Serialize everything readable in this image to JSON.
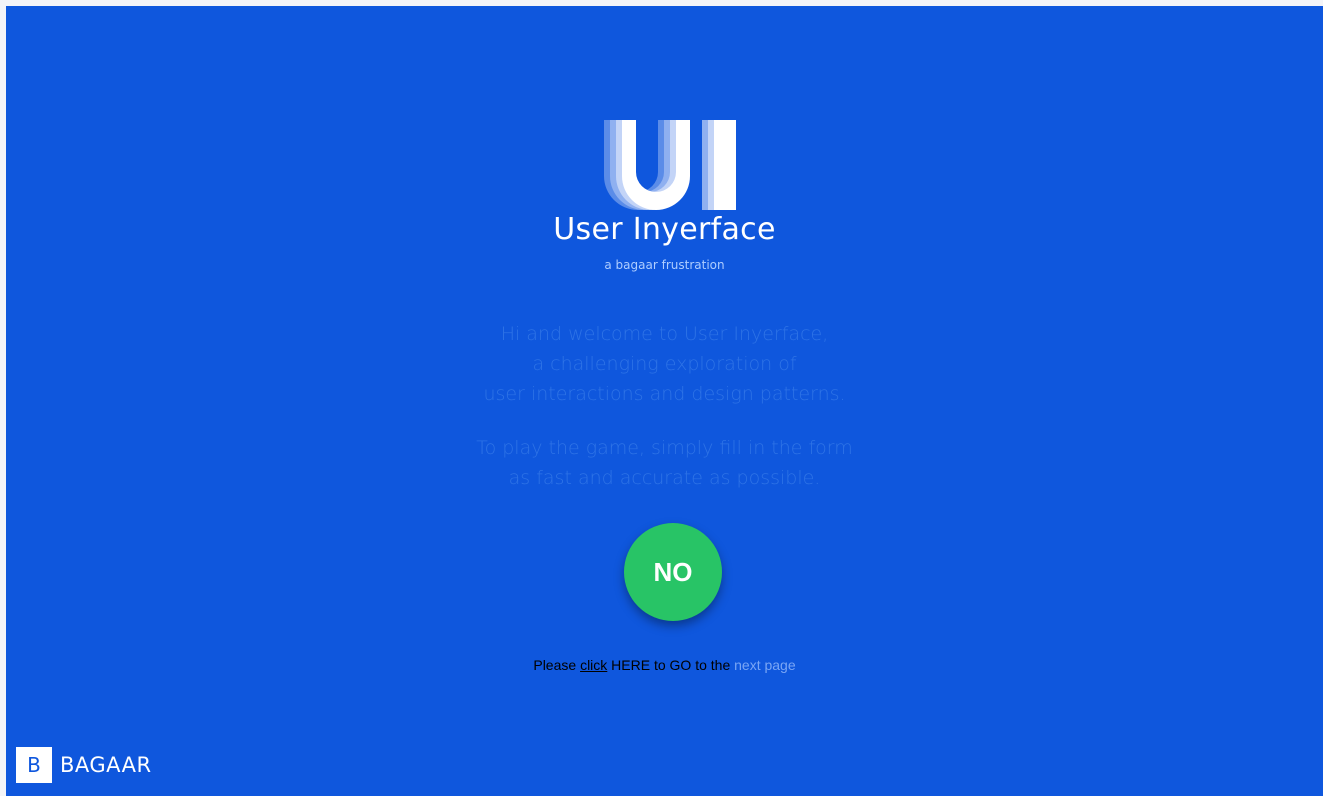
{
  "header": {
    "logo_icon": "ui-logo-icon",
    "title": "User Inyerface",
    "tagline": "a bagaar frustration"
  },
  "intro": {
    "paragraph1": [
      "Hi and welcome to User Inyerface,",
      "a challenging exploration of",
      "user interactions and design patterns."
    ],
    "paragraph2": [
      "To play the game, simply fill in the form",
      "as fast and accurate as possible."
    ]
  },
  "actions": {
    "no_button_label": "NO",
    "next_prefix": "Please ",
    "click_link": "click",
    "next_middle": " HERE to GO to the ",
    "next_page_link": "next page"
  },
  "footer": {
    "brand_letter": "B",
    "brand_name": "BAGAAR"
  },
  "colors": {
    "background": "#0f57dd",
    "button": "#28c466",
    "intro_text": "#2e73e6",
    "tagline": "#aecdff"
  }
}
